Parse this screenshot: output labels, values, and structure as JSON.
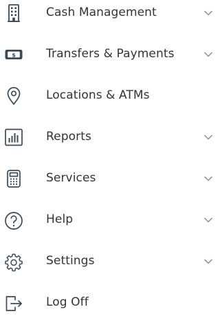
{
  "menu": {
    "items": [
      {
        "label": "Cash Management",
        "icon": "building-icon",
        "expandable": true
      },
      {
        "label": "Transfers & Payments",
        "icon": "dollar-bill-icon",
        "expandable": true
      },
      {
        "label": "Locations & ATMs",
        "icon": "location-pin-icon",
        "expandable": false
      },
      {
        "label": "Reports",
        "icon": "bar-chart-icon",
        "expandable": true
      },
      {
        "label": "Services",
        "icon": "calculator-icon",
        "expandable": true
      },
      {
        "label": "Help",
        "icon": "question-circle-icon",
        "expandable": true
      },
      {
        "label": "Settings",
        "icon": "gear-icon",
        "expandable": true
      },
      {
        "label": "Log Off",
        "icon": "logout-icon",
        "expandable": false
      }
    ]
  },
  "colors": {
    "icon": "#3c4a57",
    "label": "#333333",
    "chevron": "#8a8f94",
    "background": "#ffffff"
  }
}
